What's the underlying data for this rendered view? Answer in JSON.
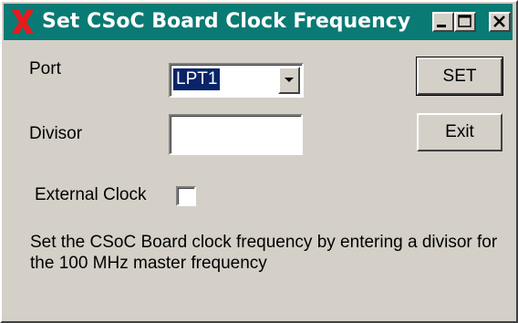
{
  "window": {
    "title": "Set CSoC Board Clock Frequency",
    "icon": "x-logo-icon",
    "controls": [
      "minimize-icon",
      "maximize-icon",
      "close-icon"
    ]
  },
  "form": {
    "port_label": "Port",
    "port_value": "LPT1",
    "divisor_label": "Divisor",
    "divisor_value": "",
    "external_clock_label": "External Clock",
    "external_clock_checked": false
  },
  "buttons": {
    "set_label": "SET",
    "exit_label": "Exit"
  },
  "description": "Set the CSoC Board clock frequency by entering a divisor for the 100 MHz master frequency",
  "colors": {
    "titlebar": "#0a7a74",
    "face": "#d4d0c8",
    "selection": "#0a246a",
    "icon_red": "#e8181c"
  }
}
